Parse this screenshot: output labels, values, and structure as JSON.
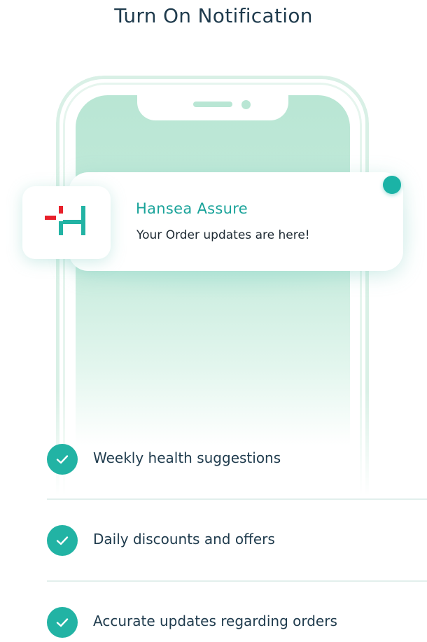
{
  "header": {
    "title": "Turn On Notification"
  },
  "notification": {
    "app_name": "Hansea Assure",
    "message": "Your Order updates are here!",
    "app_icon": "hansea-logo-icon",
    "unread_dot_color": "#1bb3a6"
  },
  "benefits": [
    {
      "label": "Weekly health suggestions",
      "icon": "check-icon"
    },
    {
      "label": "Daily discounts and offers",
      "icon": "check-icon"
    },
    {
      "label": "Accurate updates regarding orders",
      "icon": "check-icon"
    }
  ],
  "colors": {
    "accent": "#22b3a4",
    "title_text": "#1f3b4d",
    "phone_screen": "#b9e6d4",
    "logo_red": "#e8202a",
    "logo_teal": "#22b3a4"
  }
}
